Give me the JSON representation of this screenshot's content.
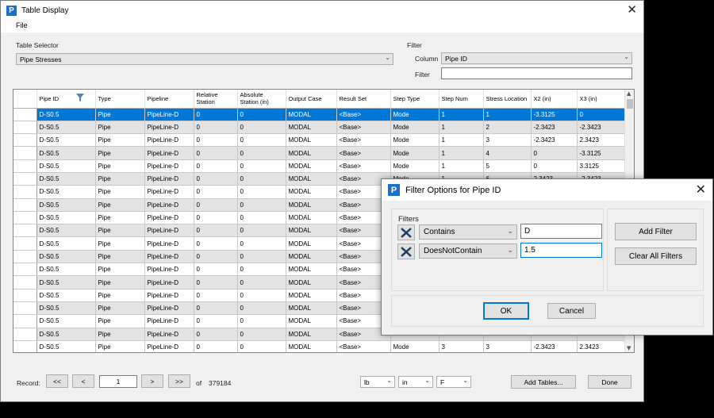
{
  "window": {
    "title": "Table Display",
    "close_glyph": "✕"
  },
  "menu": {
    "file": "File"
  },
  "table_selector": {
    "label": "Table Selector",
    "value": "Pipe Stresses"
  },
  "filter": {
    "label": "Filter",
    "column_label": "Column",
    "column_value": "Pipe ID",
    "filter_label": "Filter",
    "filter_value": ""
  },
  "grid": {
    "headers": [
      "Pipe ID",
      "Type",
      "Pipeline",
      "Relative Station",
      "Absolute Station (in)",
      "Output Case",
      "Result Set",
      "Step Type",
      "Step Num",
      "Stress Location",
      "X2 (in)",
      "X3 (in)"
    ],
    "rows": [
      [
        "D-S0.5",
        "Pipe",
        "PipeLine-D",
        "0",
        "0",
        "MODAL",
        "<Base>",
        "Mode",
        "1",
        "1",
        "-3.3125",
        "0"
      ],
      [
        "D-S0.5",
        "Pipe",
        "PipeLine-D",
        "0",
        "0",
        "MODAL",
        "<Base>",
        "Mode",
        "1",
        "2",
        "-2.3423",
        "-2.3423"
      ],
      [
        "D-S0.5",
        "Pipe",
        "PipeLine-D",
        "0",
        "0",
        "MODAL",
        "<Base>",
        "Mode",
        "1",
        "3",
        "-2.3423",
        "2.3423"
      ],
      [
        "D-S0.5",
        "Pipe",
        "PipeLine-D",
        "0",
        "0",
        "MODAL",
        "<Base>",
        "Mode",
        "1",
        "4",
        "0",
        "-3.3125"
      ],
      [
        "D-S0.5",
        "Pipe",
        "PipeLine-D",
        "0",
        "0",
        "MODAL",
        "<Base>",
        "Mode",
        "1",
        "5",
        "0",
        "3.3125"
      ],
      [
        "D-S0.5",
        "Pipe",
        "PipeLine-D",
        "0",
        "0",
        "MODAL",
        "<Base>",
        "Mode",
        "1",
        "6",
        "2.3423",
        "-2.3423"
      ],
      [
        "D-S0.5",
        "Pipe",
        "PipeLine-D",
        "0",
        "0",
        "MODAL",
        "<Base>",
        "",
        "",
        "",
        "",
        ""
      ],
      [
        "D-S0.5",
        "Pipe",
        "PipeLine-D",
        "0",
        "0",
        "MODAL",
        "<Base>",
        "",
        "",
        "",
        "",
        ""
      ],
      [
        "D-S0.5",
        "Pipe",
        "PipeLine-D",
        "0",
        "0",
        "MODAL",
        "<Base>",
        "",
        "",
        "",
        "",
        ""
      ],
      [
        "D-S0.5",
        "Pipe",
        "PipeLine-D",
        "0",
        "0",
        "MODAL",
        "<Base>",
        "",
        "",
        "",
        "",
        ""
      ],
      [
        "D-S0.5",
        "Pipe",
        "PipeLine-D",
        "0",
        "0",
        "MODAL",
        "<Base>",
        "",
        "",
        "",
        "",
        ""
      ],
      [
        "D-S0.5",
        "Pipe",
        "PipeLine-D",
        "0",
        "0",
        "MODAL",
        "<Base>",
        "",
        "",
        "",
        "",
        ""
      ],
      [
        "D-S0.5",
        "Pipe",
        "PipeLine-D",
        "0",
        "0",
        "MODAL",
        "<Base>",
        "",
        "",
        "",
        "",
        ""
      ],
      [
        "D-S0.5",
        "Pipe",
        "PipeLine-D",
        "0",
        "0",
        "MODAL",
        "<Base>",
        "",
        "",
        "",
        "",
        ""
      ],
      [
        "D-S0.5",
        "Pipe",
        "PipeLine-D",
        "0",
        "0",
        "MODAL",
        "<Base>",
        "",
        "",
        "",
        "",
        ""
      ],
      [
        "D-S0.5",
        "Pipe",
        "PipeLine-D",
        "0",
        "0",
        "MODAL",
        "<Base>",
        "",
        "",
        "",
        "",
        ""
      ],
      [
        "D-S0.5",
        "Pipe",
        "PipeLine-D",
        "0",
        "0",
        "MODAL",
        "<Base>",
        "",
        "",
        "",
        "",
        ""
      ],
      [
        "D-S0.5",
        "Pipe",
        "PipeLine-D",
        "0",
        "0",
        "MODAL",
        "<Base>",
        "",
        "",
        "",
        "",
        ""
      ],
      [
        "D-S0.5",
        "Pipe",
        "PipeLine-D",
        "0",
        "0",
        "MODAL",
        "<Base>",
        "Mode",
        "3",
        "3",
        "-2.3423",
        "2.3423"
      ]
    ]
  },
  "record": {
    "label": "Record:",
    "first": "<<",
    "prev": "<",
    "current": "1",
    "next": ">",
    "last": ">>",
    "of": "of",
    "total": "379184"
  },
  "units": {
    "force": "lb",
    "length": "in",
    "temp": "F"
  },
  "buttons": {
    "add_tables": "Add Tables...",
    "done": "Done"
  },
  "dialog": {
    "title": "Filter Options for Pipe ID",
    "filters_label": "Filters",
    "filter1_op": "Contains",
    "filter1_value": "D",
    "filter2_op": "DoesNotContain",
    "filter2_value": "1.5",
    "add_filter": "Add Filter",
    "clear_all": "Clear All Filters",
    "ok": "OK",
    "cancel": "Cancel"
  },
  "icons": {
    "app": "app-logo-icon",
    "filter": "funnel-icon",
    "remove": "remove-filter-icon"
  }
}
